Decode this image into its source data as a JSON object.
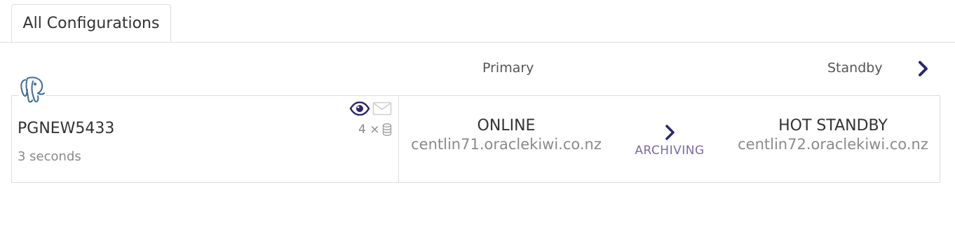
{
  "tabs": [
    {
      "label": "All Configurations"
    }
  ],
  "columns": {
    "primary": "Primary",
    "standby": "Standby"
  },
  "icons": {
    "logo": "postgresql-elephant-icon",
    "view": "eye-icon",
    "message": "envelope-icon",
    "database": "database-icon",
    "next": "chevron-right-icon"
  },
  "colors": {
    "accent": "#2b2673",
    "muted": "#8a8a8a",
    "transport": "#7a6aa8",
    "border": "#dddddd"
  },
  "configuration": {
    "name": "PGNEW5433",
    "age": "3 seconds",
    "database_count": "4 ×",
    "primary": {
      "state": "ONLINE",
      "host": "centlin71.oraclekiwi.co.nz"
    },
    "transport": "ARCHIVING",
    "standby": {
      "state": "HOT STANDBY",
      "host": "centlin72.oraclekiwi.co.nz"
    }
  }
}
